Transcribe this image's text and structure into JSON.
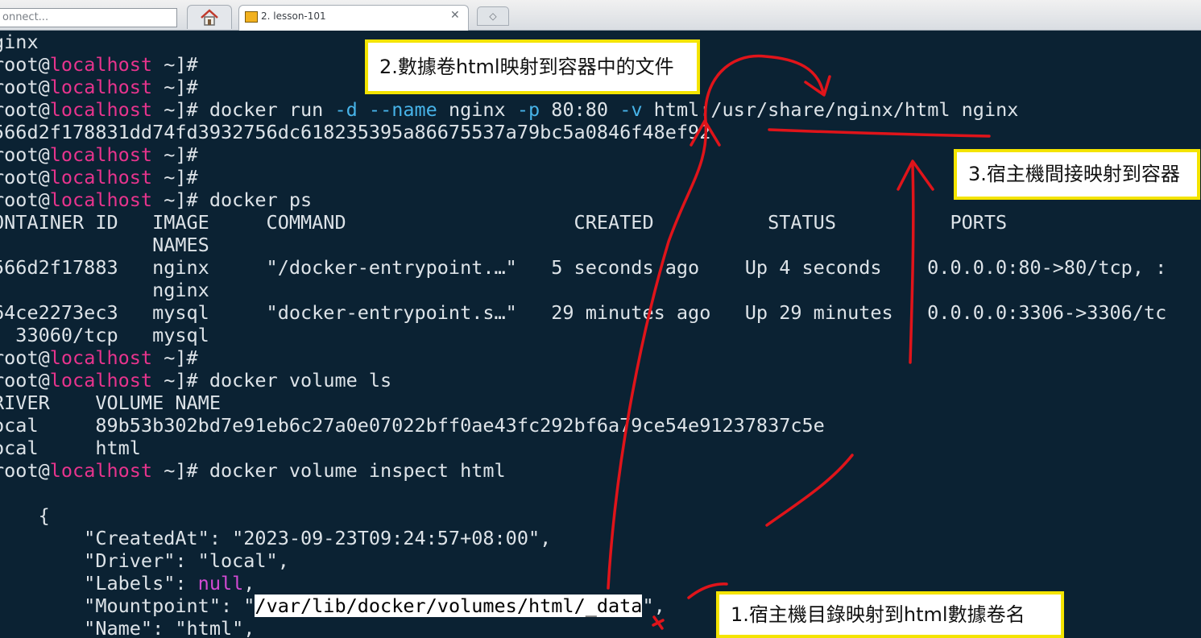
{
  "tabbar": {
    "connect_text": "onnect...",
    "home_icon": "home-icon",
    "tab_icon": "terminal-icon",
    "tab_title": "2. lesson-101",
    "tab_close": "✕",
    "new_tab_icon": "◇"
  },
  "prompt": {
    "user": "root@",
    "host": "localhost",
    "suffix": " ~]#"
  },
  "terminal": {
    "l0": "ginx",
    "l3_cmd1": " docker run ",
    "l3_f1": "-d",
    "l3_sp1": " ",
    "l3_f2": "--name",
    "l3_cmd2": " nginx ",
    "l3_f3": "-p",
    "l3_cmd3": " 80:80 ",
    "l3_f4": "-v",
    "l3_cmd4": " html:/usr/share/nginx/html nginx",
    "l4": "566d2f178831dd74fd3932756dc618235395a86675537a79bc5a0846f48ef92",
    "l7_cmd": " docker ps",
    "l8": "ONTAINER ID   IMAGE     COMMAND                    CREATED          STATUS          PORTS",
    "l9": "              NAMES",
    "l10": "566d2f17883   nginx     \"/docker-entrypoint.…\"   5 seconds ago    Up 4 seconds    0.0.0.0:80->80/tcp, :",
    "l11": "              nginx",
    "l12": "64ce2273ec3   mysql     \"docker-entrypoint.s…\"   29 minutes ago   Up 29 minutes   0.0.0.0:3306->3306/tc",
    "l13": ", 33060/tcp   mysql",
    "l15_cmd": " docker volume ls",
    "l16": "RIVER    VOLUME NAME",
    "l17": "ocal     89b53b302bd7e91eb6c27a0e07022bff0ae43fc292bf6a79ce54e91237837c5e",
    "l18": "ocal     html",
    "l19_cmd": " docker volume inspect html",
    "l21": "    {",
    "l22": "        \"CreatedAt\": \"2023-09-23T09:24:57+08:00\",",
    "l23": "        \"Driver\": \"local\",",
    "l24_a": "        \"Labels\": ",
    "l24_null": "null",
    "l24_b": ",",
    "l25_a": "        \"Mountpoint\": \"",
    "l25_path": "/var/lib/docker/volumes/html/_data",
    "l25_b": "\",",
    "l26": "        \"Name\": \"html\","
  },
  "annotations": {
    "box1": "1.宿主機目錄映射到html數據卷名",
    "box2": "2.數據卷html映射到容器中的文件",
    "box3": "3.宿主機間接映射到容器",
    "box_border_color": "#f4e400",
    "ink_color": "#e0141a"
  },
  "colors": {
    "background": "#0b2233",
    "text": "#dde3e8",
    "hostname": "#e7348d",
    "flag": "#47b3e8",
    "null_keyword": "#d24ad2"
  }
}
